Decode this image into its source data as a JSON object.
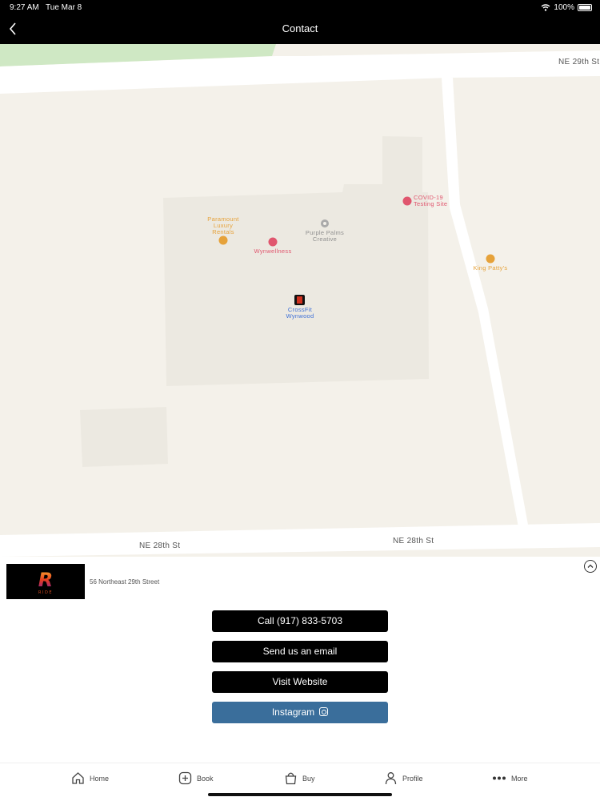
{
  "status_bar": {
    "time": "9:27 AM",
    "date": "Tue Mar 8",
    "battery": "100%"
  },
  "header": {
    "title": "Contact",
    "back_icon": "chevron-left-icon"
  },
  "map": {
    "streets": [
      "NE 29th St",
      "NE 28th St",
      "NE 28th St"
    ],
    "pois": [
      {
        "label": "Paramount Luxury Rentals",
        "lines": [
          "Paramount",
          "Luxury",
          "Rentals"
        ],
        "color": "#e6a23a"
      },
      {
        "label": "Purple Palms Creative",
        "lines": [
          "Purple Palms",
          "Creative"
        ],
        "color": "#8f8f8f"
      },
      {
        "label": "Wynwellness",
        "lines": [
          "Wynwellness"
        ],
        "color": "#e0566e"
      },
      {
        "label": "COVID-19 Testing Site",
        "lines": [
          "COVID-19",
          "Testing Site"
        ],
        "color": "#e0566e"
      },
      {
        "label": "King Patty's",
        "lines": [
          "King Patty's"
        ],
        "color": "#e6a23a"
      },
      {
        "label": "CrossFit Wynwood",
        "lines": [
          "CrossFit",
          "Wynwood"
        ],
        "color": "#3d6fd6"
      }
    ]
  },
  "location": {
    "address": "56 Northeast 29th Street",
    "logo_text": "R",
    "logo_subtext": "RIDE"
  },
  "actions": {
    "call": "Call (917) 833-5703",
    "email": "Send us an email",
    "website": "Visit Website",
    "instagram": "Instagram"
  },
  "tabs": [
    {
      "label": "Home",
      "icon": "home-icon"
    },
    {
      "label": "Book",
      "icon": "plus-square-icon"
    },
    {
      "label": "Buy",
      "icon": "bag-icon"
    },
    {
      "label": "Profile",
      "icon": "person-icon"
    },
    {
      "label": "More",
      "icon": "more-dots-icon"
    }
  ],
  "colors": {
    "bar_bg": "#000000",
    "instagram_button": "#3a6e9b",
    "map_bg": "#f4f1ea"
  }
}
